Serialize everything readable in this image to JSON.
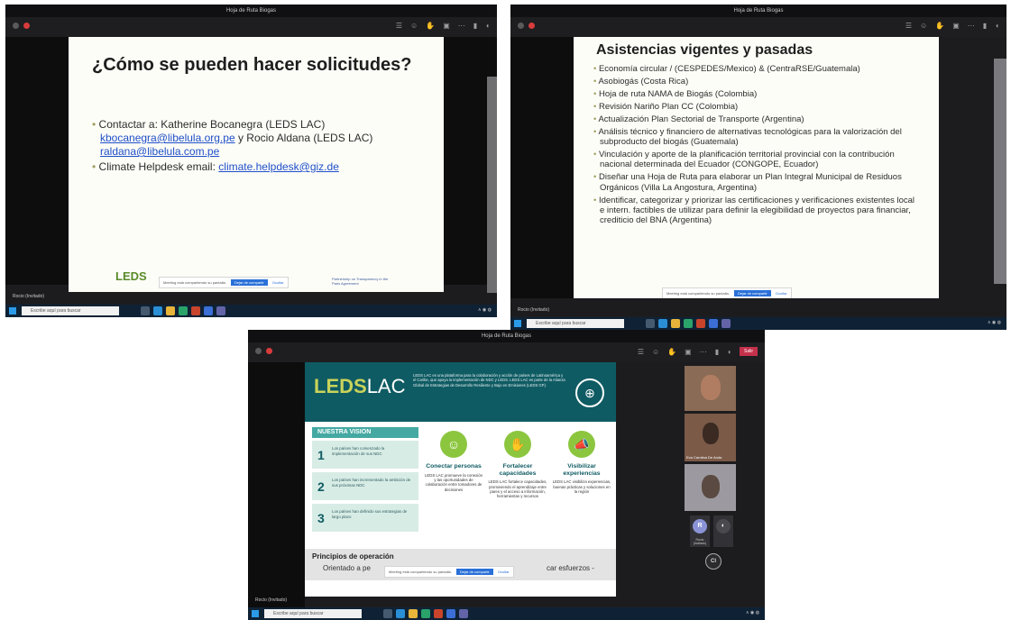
{
  "window_title": "Hoja de Ruta Biogas",
  "presenter_name": "Rocio (Invitado)",
  "search_placeholder": "Escribe aquí para buscar",
  "screen_share_banner": {
    "message": "Meeting está compartiendo su pantalla.",
    "stop_label": "Dejar de compartir",
    "hide_label": "Ocultar"
  },
  "footer_logo": "LEDS",
  "partnership_logo": "Partnership on Transparency in the Paris Agreement",
  "slide1": {
    "title": "¿Cómo se pueden hacer solicitudes?",
    "bullet1_prefix": "Contactar a: Katherine Bocanegra (LEDS LAC)",
    "email1": "kbocanegra@libelula.org.pe",
    "bullet1_mid": "y Rocio Aldana (LEDS LAC)",
    "email2": "raldana@libelula.com.pe",
    "bullet2_prefix": "Climate Helpdesk email:",
    "email3": "climate.helpdesk@giz.de"
  },
  "slide2": {
    "title": "Asistencias vigentes y pasadas",
    "items": [
      "Economía circular / (CESPEDES/Mexico) & (CentraRSE/Guatemala)",
      "Asobiogás (Costa Rica)",
      "Hoja de ruta NAMA de Biogás (Colombia)",
      "Revisión Nariño Plan CC (Colombia)",
      "Actualización Plan Sectorial de Transporte (Argentina)",
      "Análisis técnico y financiero de alternativas tecnológicas para la valorización del subproducto del biogás (Guatemala)",
      "Vinculación y aporte de la planificación territorial provincial con la contribución nacional determinada del Ecuador (CONGOPE, Ecuador)",
      "Diseñar una Hoja de Ruta para elaborar un Plan Integral Municipal de Residuos Orgánicos (Villa La Angostura, Argentina)",
      "Identificar, categorizar y priorizar las certificaciones y verificaciones existentes local e intern. factibles de utilizar para definir la elegibilidad de proyectos para financiar, crediticio del BNA (Argentina)"
    ]
  },
  "slide3": {
    "logo_main": "LEDS",
    "logo_sub": "LAC",
    "description": "LEDS LAC es una plataforma para la colaboración y acción de países de Latinoamérica y el Caribe, que apoya la implementación de NDC y LEDS. LEDS LAC es parte de la Alianza Global de Estrategias de Desarrollo Resiliente y Bajo en Emisiones (LEDS GP).",
    "vision_title": "NUESTRA VISION",
    "vision_items": [
      {
        "num": "1",
        "text": "Los países han comenzado la implementación de sus NDC"
      },
      {
        "num": "2",
        "text": "Los países han incrementado la ambición de sus próximas NDC"
      },
      {
        "num": "3",
        "text": "Los países han definido sus estrategias de largo plazo"
      }
    ],
    "columns": [
      {
        "title": "Conectar personas",
        "desc": "LEDS LAC promueve la conexión y las oportunidades de colaboración entre tomadores de decisiones"
      },
      {
        "title": "Fortalecer capacidades",
        "desc": "LEDS LAC fortalece capacidades, promoviendo el aprendizaje entre pares y el acceso a información, herramientas y recursos"
      },
      {
        "title": "Visibilizar experiencias",
        "desc": "LEDS LAC visibiliza experiencias, buenas prácticas y soluciones en la región"
      }
    ],
    "principios_title": "Principios de operación",
    "principios_text": "Orientado a pe",
    "principios_tail": "car esfuerzos -"
  },
  "participants": {
    "avatar_r": "R",
    "avatar_cl": "Cl",
    "participant_r_name": "Rocio (Invitado)",
    "participant2_name": "Eva Carolina De Anda"
  },
  "leave_label": "Salir",
  "colors": {
    "leds_teal": "#0f5b63",
    "leds_green": "#8cc63f",
    "vision_light": "#d8ece6",
    "leave_red": "#c4314b",
    "link_blue": "#1f4fc8"
  }
}
